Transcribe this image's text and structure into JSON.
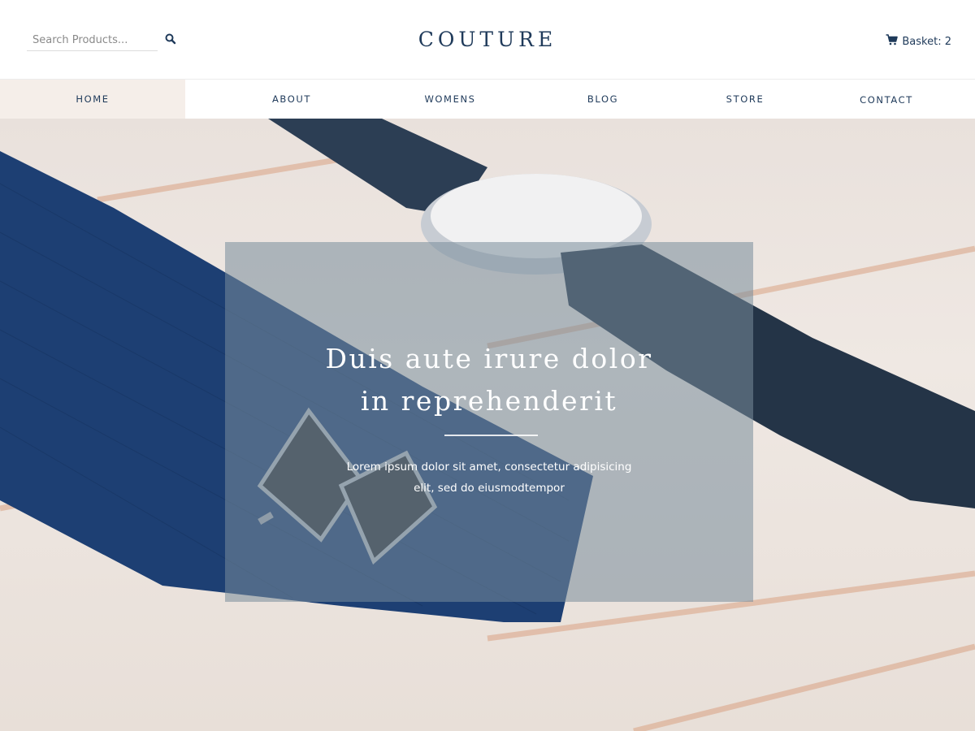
{
  "header": {
    "search_placeholder": "Search Products...",
    "logo": "COUTURE",
    "basket_label": "Basket: 2",
    "search_icon": "search-icon",
    "basket_icon": "cart-icon"
  },
  "nav": {
    "items": [
      {
        "label": "HOME",
        "active": true
      },
      {
        "label": "ABOUT",
        "active": false
      },
      {
        "label": "WOMENS",
        "active": false
      },
      {
        "label": "BLOG",
        "active": false
      },
      {
        "label": "STORE",
        "active": false
      },
      {
        "label": "CONTACT",
        "active": false
      }
    ]
  },
  "hero": {
    "title_line1": "Duis aute irure dolor",
    "title_line2": "in reprehenderit",
    "subtitle_line1": "Lorem ipsum dolor sit amet, consectetur adipisicing",
    "subtitle_line2": "elit, sed do eiusmodtempor"
  },
  "colors": {
    "primary": "#1f3a5a",
    "nav_active_bg": "#f5eee9",
    "tie_blue": "#1d3f73",
    "overlay": "#788c9b"
  }
}
